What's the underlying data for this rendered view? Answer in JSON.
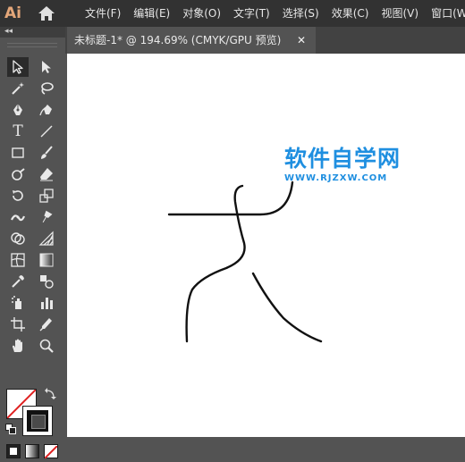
{
  "app": {
    "logo": "Ai"
  },
  "menubar": {
    "items": [
      "文件(F)",
      "编辑(E)",
      "对象(O)",
      "文字(T)",
      "选择(S)",
      "效果(C)",
      "视图(V)",
      "窗口(W)"
    ]
  },
  "document": {
    "tab_title": "未标题-1* @ 194.69% (CMYK/GPU 预览)",
    "close_glyph": "✕"
  },
  "toolpanel": {
    "collapse_glyph": "◂◂",
    "text_tool_glyph": "T",
    "tools": [
      "selection",
      "direct-selection",
      "magic-wand",
      "lasso",
      "pen",
      "curvature",
      "type",
      "line-segment",
      "rectangle",
      "paintbrush",
      "shaper",
      "eraser",
      "rotate",
      "scale",
      "width",
      "puppet-warp",
      "shape-builder",
      "perspective-grid",
      "mesh",
      "gradient",
      "eyedropper",
      "blend",
      "symbol-sprayer",
      "column-graph",
      "artboard",
      "slice",
      "hand",
      "zoom"
    ],
    "active_tool": "selection",
    "fill_color": "#ffffff",
    "stroke_color": "#111111"
  },
  "watermark": {
    "title": "软件自学网",
    "url": "WWW.RJZXW.COM",
    "color": "#1f8fe0"
  }
}
